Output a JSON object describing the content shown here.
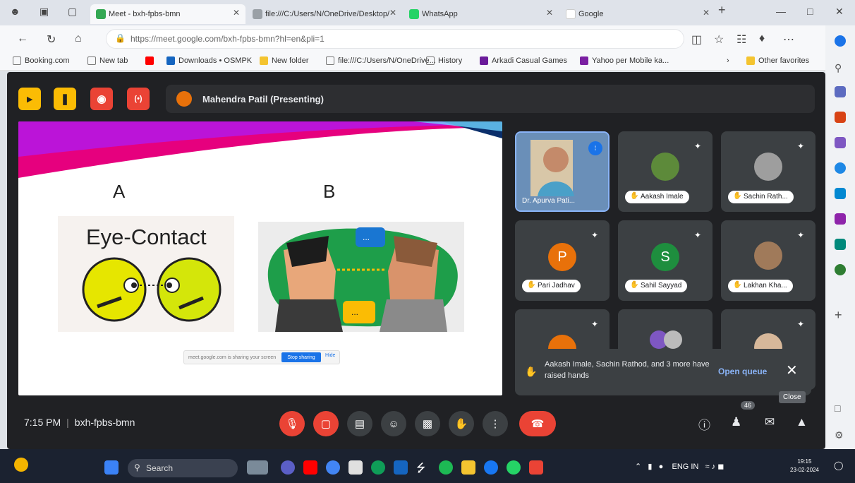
{
  "browser": {
    "tabs": [
      {
        "title": "Meet - bxh-fpbs-bmn",
        "active": true
      },
      {
        "title": "file:///C:/Users/N/OneDrive/Desktop/",
        "active": false
      },
      {
        "title": "WhatsApp",
        "active": false
      },
      {
        "title": "Google",
        "active": false
      }
    ],
    "address": "https://meet.google.com/bxh-fpbs-bmn?hl=en&pli=1",
    "bookmarks": [
      "Booking.com",
      "New tab",
      "Downloads • OSMPK",
      "New folder",
      "file:///C:/Users/N/OneDrive...",
      "History",
      "Arkadi Casual Games",
      "Yahoo per Mobile ka...",
      "Other favorites"
    ]
  },
  "meet": {
    "presenter_bar": "Mahendra Patil (Presenting)",
    "slide": {
      "label_a": "A",
      "label_b": "B",
      "eye_title": "Eye-Contact",
      "share_bar_text": "meet.google.com is sharing your screen",
      "stop_sharing": "Stop sharing",
      "hide": "Hide"
    },
    "participants": [
      {
        "name": "Dr. Apurva Pati...",
        "speaking": true,
        "kind": "video"
      },
      {
        "name": "Aakash Imale",
        "kind": "photo",
        "color": "#5d8a3a"
      },
      {
        "name": "Sachin Rath...",
        "kind": "photo",
        "color": "#8c8c8c"
      },
      {
        "name": "Pari Jadhav",
        "kind": "letter",
        "letter": "P",
        "color": "#e8710a"
      },
      {
        "name": "Sahil Sayyad",
        "kind": "letter",
        "letter": "S",
        "color": "#1e8e3e"
      },
      {
        "name": "Lakhan Kha...",
        "kind": "photo",
        "color": "#a07a5a"
      }
    ],
    "toast": {
      "message": "Aakash Imale, Sachin Rathod, and 3 more have raised hands",
      "open_queue": "Open queue",
      "tooltip": "Close"
    },
    "bottom": {
      "time": "7:15 PM",
      "meeting_code": "bxh-fpbs-bmn",
      "participant_count": "46"
    }
  },
  "taskbar": {
    "search": "Search",
    "lang": "ENG IN",
    "clock_time": "19:15",
    "clock_date": "23-02-2024"
  },
  "colors": {
    "meet_bg": "#202124",
    "tile_bg": "#3c4043",
    "red": "#ea4335",
    "accent_blue": "#8ab4f8"
  }
}
